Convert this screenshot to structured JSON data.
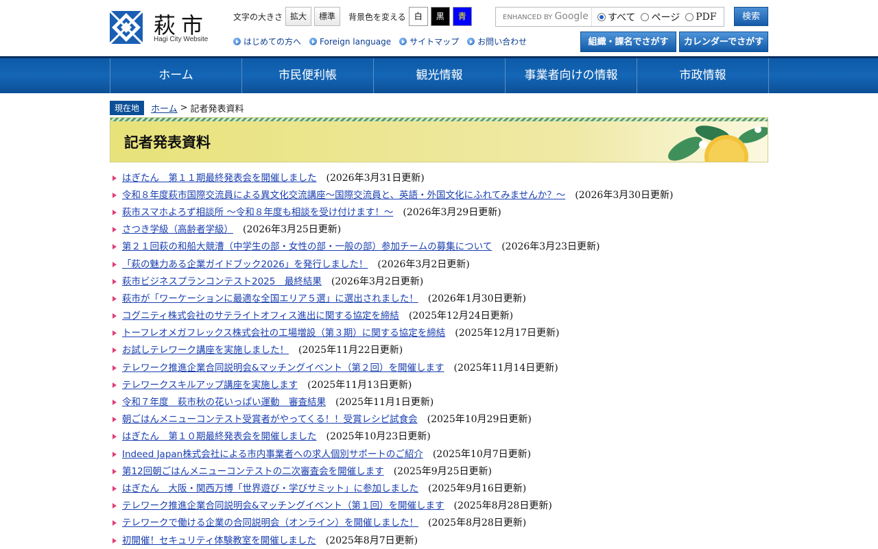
{
  "logo": {
    "name": "萩市",
    "sub": "Hagi City Website"
  },
  "tools": {
    "font_size_label": "文字の大きさ",
    "enlarge": "拡大",
    "standard": "標準",
    "bg_label": "背景色を変える",
    "white": "白",
    "black": "黒",
    "blue": "青"
  },
  "links": [
    {
      "label": "はじめての方へ"
    },
    {
      "label": "Foreign language"
    },
    {
      "label": "サイトマップ"
    },
    {
      "label": "お問い合わせ"
    }
  ],
  "search": {
    "gcse_label": "ENHANCED BY",
    "gcse_brand": "Google",
    "opt_all": "すべて",
    "opt_page": "ページ",
    "opt_pdf": "PDF",
    "button": "検索"
  },
  "quick": {
    "org": "組織・課名でさがす",
    "calendar": "カレンダーでさがす"
  },
  "nav": [
    {
      "label": "ホーム"
    },
    {
      "label": "市民便利帳"
    },
    {
      "label": "観光情報"
    },
    {
      "label": "事業者向けの情報"
    },
    {
      "label": "市政情報"
    }
  ],
  "breadcrumb": {
    "here": "現在地",
    "home": "ホーム",
    "sep": ">",
    "current": "記者発表資料"
  },
  "page_title": "記者発表資料",
  "items": [
    {
      "title": "はぎたん　第１１期最終発表会を開催しました",
      "date": "(2026年3月31日更新)"
    },
    {
      "title": "令和８年度萩市国際交流員による異文化交流講座～国際交流員と、英語・外国文化にふれてみませんか？～",
      "date": "(2026年3月30日更新)"
    },
    {
      "title": "萩市スマホよろず相談所 ～令和８年度も相談を受け付けます！～",
      "date": "(2026年3月29日更新)"
    },
    {
      "title": "さつき学級（高齢者学級）",
      "date": "(2026年3月25日更新)"
    },
    {
      "title": "第２１回萩の和船大競漕（中学生の部・女性の部・一般の部）参加チームの募集について",
      "date": "(2026年3月23日更新)"
    },
    {
      "title": "「萩の魅力ある企業ガイドブック2026」を発行しました！",
      "date": "(2026年3月2日更新)"
    },
    {
      "title": "萩市ビジネスプランコンテスト2025　最終結果",
      "date": "(2026年3月2日更新)"
    },
    {
      "title": "萩市が「ワーケーションに最適な全国エリア５選」に選出されました！",
      "date": "(2026年1月30日更新)"
    },
    {
      "title": "コグニティ株式会社のサテライトオフィス進出に関する協定を締結",
      "date": "(2025年12月24日更新)"
    },
    {
      "title": "トーフレオメガフレックス株式会社の工場増設（第３期）に関する協定を締結",
      "date": "(2025年12月17日更新)"
    },
    {
      "title": "お試しテレワーク講座を実施しました！",
      "date": "(2025年11月22日更新)"
    },
    {
      "title": "テレワーク推進企業合同説明会&マッチングイベント（第２回）を開催します",
      "date": "(2025年11月14日更新)"
    },
    {
      "title": "テレワークスキルアップ講座を実施します",
      "date": "(2025年11月13日更新)"
    },
    {
      "title": "令和７年度　萩市秋の花いっぱい運動　審査結果",
      "date": "(2025年11月1日更新)"
    },
    {
      "title": "朝ごはんメニューコンテスト受賞者がやってくる！！受賞レシピ試食会",
      "date": "(2025年10月29日更新)"
    },
    {
      "title": "はぎたん　第１０期最終発表会を開催しました",
      "date": "(2025年10月23日更新)"
    },
    {
      "title": "Indeed Japan株式会社による市内事業者への求人個別サポートのご紹介",
      "date": "(2025年10月7日更新)"
    },
    {
      "title": "第12回朝ごはんメニューコンテストの二次審査会を開催します",
      "date": "(2025年9月25日更新)"
    },
    {
      "title": "はぎたん　大阪・関西万博「世界遊び・学びサミット」に参加しました",
      "date": "(2025年9月16日更新)"
    },
    {
      "title": "テレワーク推進企業合同説明会&マッチングイベント（第１回）を開催します",
      "date": "(2025年8月28日更新)"
    },
    {
      "title": "テレワークで働ける企業の合同説明会（オンライン）を開催しました！",
      "date": "(2025年8月28日更新)"
    },
    {
      "title": "初開催！セキュリティ体験教室を開催しました",
      "date": "(2025年8月7日更新)"
    }
  ]
}
